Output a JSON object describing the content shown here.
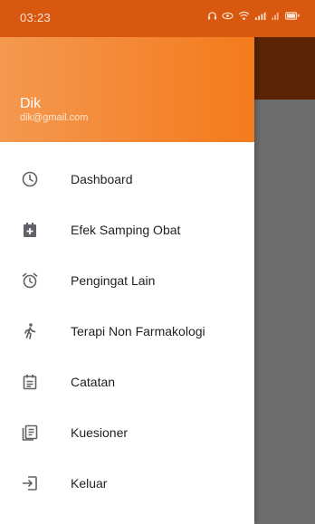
{
  "status_bar": {
    "time": "03:23"
  },
  "drawer": {
    "user": {
      "name": "Dik",
      "email": "dik@gmail.com"
    },
    "menu": [
      {
        "label": "Dashboard",
        "icon": "clock-icon"
      },
      {
        "label": "Efek Samping Obat",
        "icon": "calendar-add-icon"
      },
      {
        "label": "Pengingat Lain",
        "icon": "alarm-clock-icon"
      },
      {
        "label": "Terapi Non Farmakologi",
        "icon": "walking-person-icon"
      },
      {
        "label": "Catatan",
        "icon": "notes-icon"
      },
      {
        "label": "Kuesioner",
        "icon": "questionnaire-icon"
      },
      {
        "label": "Keluar",
        "icon": "logout-icon"
      }
    ]
  },
  "colors": {
    "status_bar": "#d8580f",
    "header_gradient_start": "#f4994f",
    "header_gradient_end": "#f37b1c",
    "icon_gray": "#5f6368",
    "scrim": "#6f6f6f"
  }
}
